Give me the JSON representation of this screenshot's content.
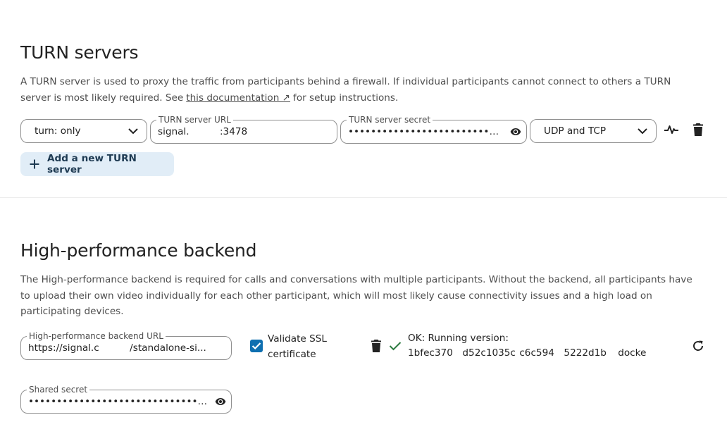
{
  "turn": {
    "title": "TURN servers",
    "description": "A TURN server is used to proxy the traffic from participants behind a firewall. If individual participants cannot connect to others a TURN server is most likely required. See",
    "doc_link": "this documentation ↗",
    "description_end": "for setup instructions.",
    "scheme_select": "turn: only",
    "url_label": "TURN server URL",
    "url_value": "signal.                :3478",
    "secret_label": "TURN server secret",
    "secret_value": "••••••••••••••••••••••••••••••••••...",
    "protocol_select": "UDP and TCP",
    "add_button": "Add a new TURN server"
  },
  "hpb": {
    "title": "High-performance backend",
    "description": "The High-performance backend is required for calls and conversations with multiple participants. Without the backend, all participants have to upload their own video individually for each other participant, which will most likely cause connectivity issues and a high load on participating devices.",
    "url_label": "High-performance backend URL",
    "url_value": "https://signal.c                /standalone-si...",
    "validate_ssl_label": "Validate SSL certificate",
    "validate_ssl_checked": true,
    "status_text": "OK: Running version:",
    "status_version": "1bfec370     d52c1035c  c6c594     5222d1b      docke",
    "secret_label": "Shared secret",
    "secret_value": "••••••••••••••••••••••••••••••••••••••••..."
  },
  "colors": {
    "accent": "#0e6fb0",
    "status_ok": "#2d7b41",
    "add_button_bg": "#e1edf7"
  }
}
